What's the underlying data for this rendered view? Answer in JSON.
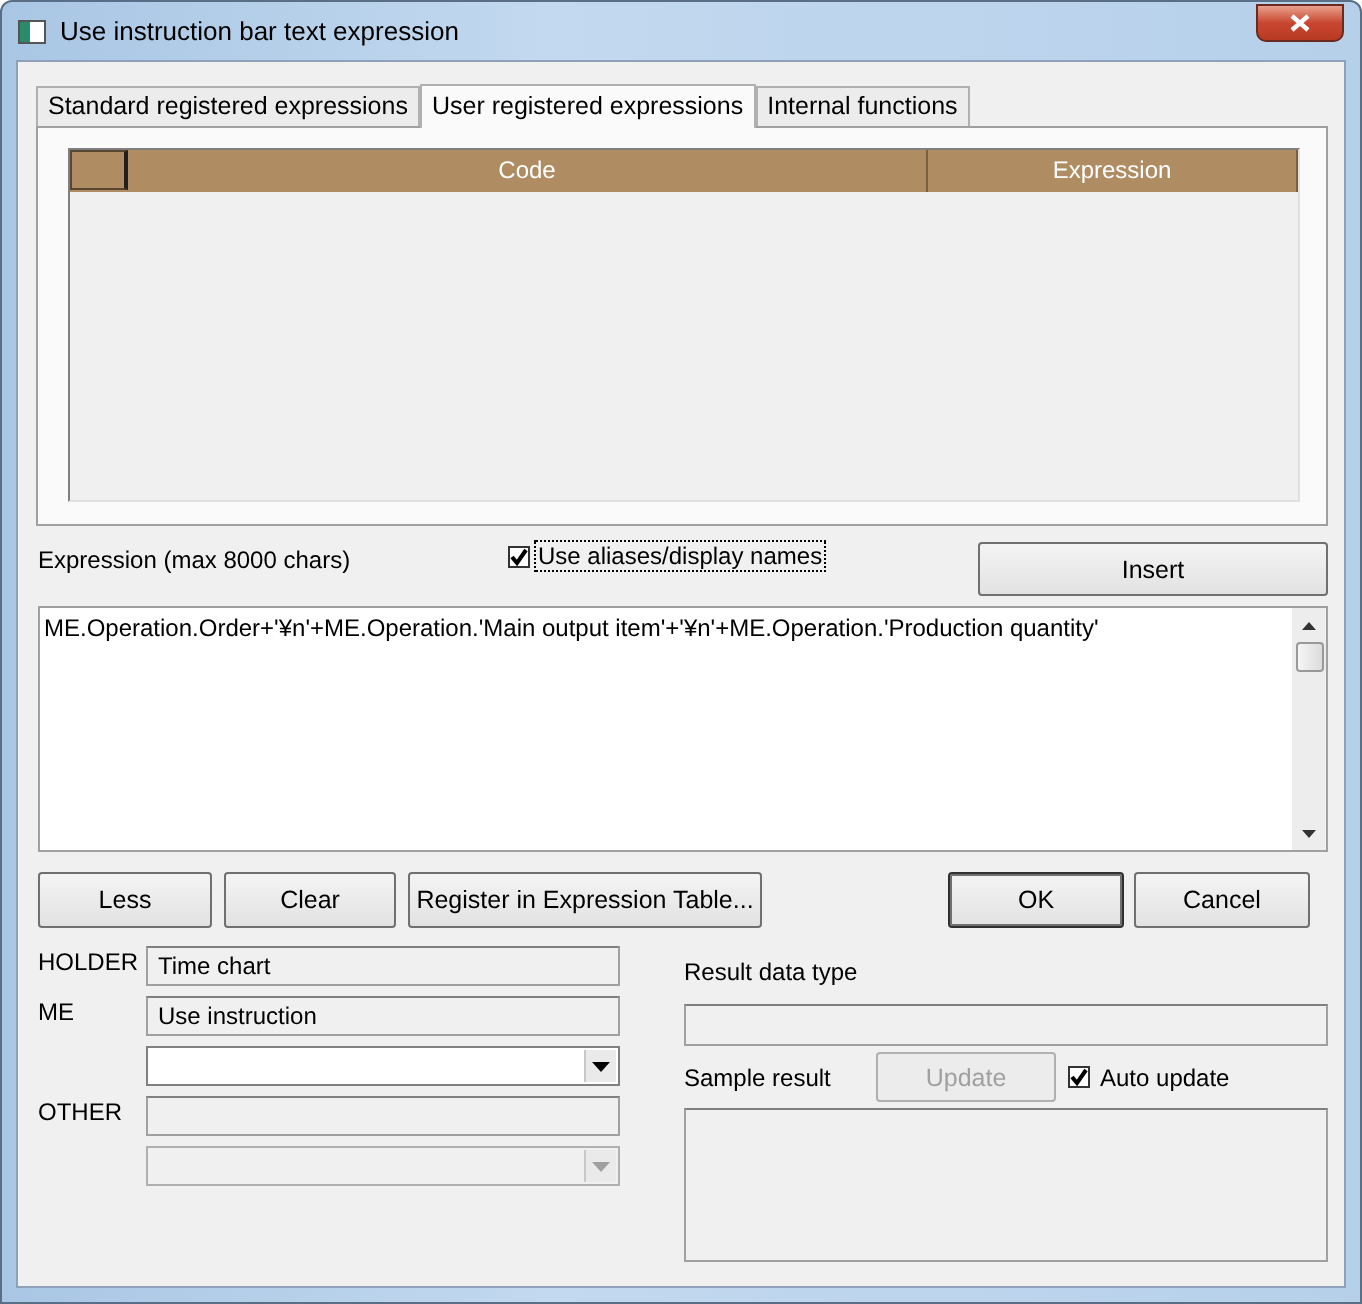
{
  "window": {
    "title": "Use instruction bar text expression"
  },
  "tabs": [
    {
      "label": "Standard registered expressions",
      "selected": false
    },
    {
      "label": "User registered expressions",
      "selected": true
    },
    {
      "label": "Internal functions",
      "selected": false
    }
  ],
  "table": {
    "columns": [
      "Code",
      "Expression"
    ]
  },
  "expression": {
    "label": "Expression (max 8000 chars)",
    "value": "ME.Operation.Order+'¥n'+ME.Operation.'Main output item'+'¥n'+ME.Operation.'Production quantity'"
  },
  "use_aliases": {
    "label": "Use aliases/display names",
    "checked": true,
    "focused": true
  },
  "insert_button": {
    "label": "Insert"
  },
  "action_buttons": [
    {
      "label": "Less"
    },
    {
      "label": "Clear"
    },
    {
      "label": "Register in Expression Table..."
    }
  ],
  "dialog_buttons": [
    {
      "label": "OK",
      "default": true
    },
    {
      "label": "Cancel",
      "default": false
    }
  ],
  "holder": {
    "label": "HOLDER",
    "value": "Time chart"
  },
  "me": {
    "label": "ME",
    "value": "Use instruction",
    "combo": {
      "disabled": false
    }
  },
  "other": {
    "label": "OTHER",
    "combo": {
      "disabled": true
    }
  },
  "result_data_type": {
    "label": "Result data type"
  },
  "sample_result": {
    "label": "Sample result",
    "update_button": {
      "label": "Update",
      "disabled": true
    },
    "auto_update": {
      "label": "Auto update",
      "checked": true
    }
  }
}
